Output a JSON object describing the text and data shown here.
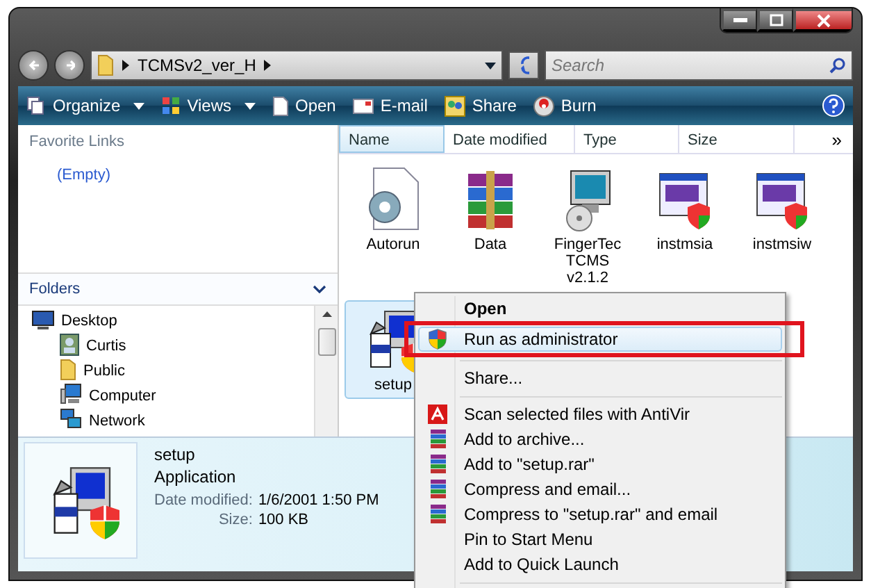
{
  "address": {
    "path": "TCMSv2_ver_H"
  },
  "search": {
    "placeholder": "Search"
  },
  "toolbar": [
    {
      "label": "Organize",
      "kind": "organize",
      "dropdown": true
    },
    {
      "label": "Views",
      "kind": "views",
      "dropdown": true
    },
    {
      "label": "Open",
      "kind": "open",
      "dropdown": false
    },
    {
      "label": "E-mail",
      "kind": "email",
      "dropdown": false
    },
    {
      "label": "Share",
      "kind": "share",
      "dropdown": false
    },
    {
      "label": "Burn",
      "kind": "burn",
      "dropdown": false
    }
  ],
  "nav": {
    "favorites_title": "Favorite Links",
    "favorites": [
      "(Empty)"
    ],
    "folders_title": "Folders",
    "tree": [
      {
        "label": "Desktop",
        "kind": "desktop",
        "children": [
          {
            "label": "Curtis",
            "kind": "user"
          },
          {
            "label": "Public",
            "kind": "folder"
          },
          {
            "label": "Computer",
            "kind": "computer"
          },
          {
            "label": "Network",
            "kind": "network"
          }
        ]
      }
    ]
  },
  "columns": [
    {
      "label": "Name",
      "sorted": true
    },
    {
      "label": "Date modified",
      "sorted": false
    },
    {
      "label": "Type",
      "sorted": false
    },
    {
      "label": "Size",
      "sorted": false
    }
  ],
  "more_columns": "»",
  "files": [
    {
      "name": "Autorun",
      "kind": "config",
      "selected": false
    },
    {
      "name": "Data",
      "kind": "archive",
      "selected": false
    },
    {
      "name": "FingerTec TCMS v2.1.2",
      "kind": "installer",
      "selected": false
    },
    {
      "name": "instmsia",
      "kind": "msi",
      "selected": false
    },
    {
      "name": "instmsiw",
      "kind": "msi",
      "selected": false
    },
    {
      "name": "setup",
      "kind": "setup",
      "selected": true
    }
  ],
  "context_menu": [
    {
      "kind": "plain",
      "label": "Open",
      "default": true,
      "selected": false,
      "outlined": false
    },
    {
      "kind": "elevated",
      "label": "Run as administrator",
      "default": false,
      "selected": true,
      "outlined": true
    },
    {
      "kind": "separator"
    },
    {
      "kind": "plain",
      "label": "Share...",
      "default": false,
      "selected": false,
      "outlined": false
    },
    {
      "kind": "separator"
    },
    {
      "kind": "antivirus",
      "label": "Scan selected files with AntiVir",
      "default": false,
      "selected": false,
      "outlined": false
    },
    {
      "kind": "archiver",
      "label": "Add to archive...",
      "default": false,
      "selected": false,
      "outlined": false
    },
    {
      "kind": "archiver",
      "label": "Add to \"setup.rar\"",
      "default": false,
      "selected": false,
      "outlined": false
    },
    {
      "kind": "archiver",
      "label": "Compress and email...",
      "default": false,
      "selected": false,
      "outlined": false
    },
    {
      "kind": "archiver",
      "label": "Compress to \"setup.rar\" and email",
      "default": false,
      "selected": false,
      "outlined": false
    },
    {
      "kind": "plain",
      "label": "Pin to Start Menu",
      "default": false,
      "selected": false,
      "outlined": false
    },
    {
      "kind": "plain",
      "label": "Add to Quick Launch",
      "default": false,
      "selected": false,
      "outlined": false
    },
    {
      "kind": "separator"
    }
  ],
  "details": {
    "name": "setup",
    "type": "Application",
    "fields": [
      {
        "label": "Date modified:",
        "value": "1/6/2001 1:50 PM"
      },
      {
        "label": "Size:",
        "value": "100 KB"
      }
    ]
  }
}
